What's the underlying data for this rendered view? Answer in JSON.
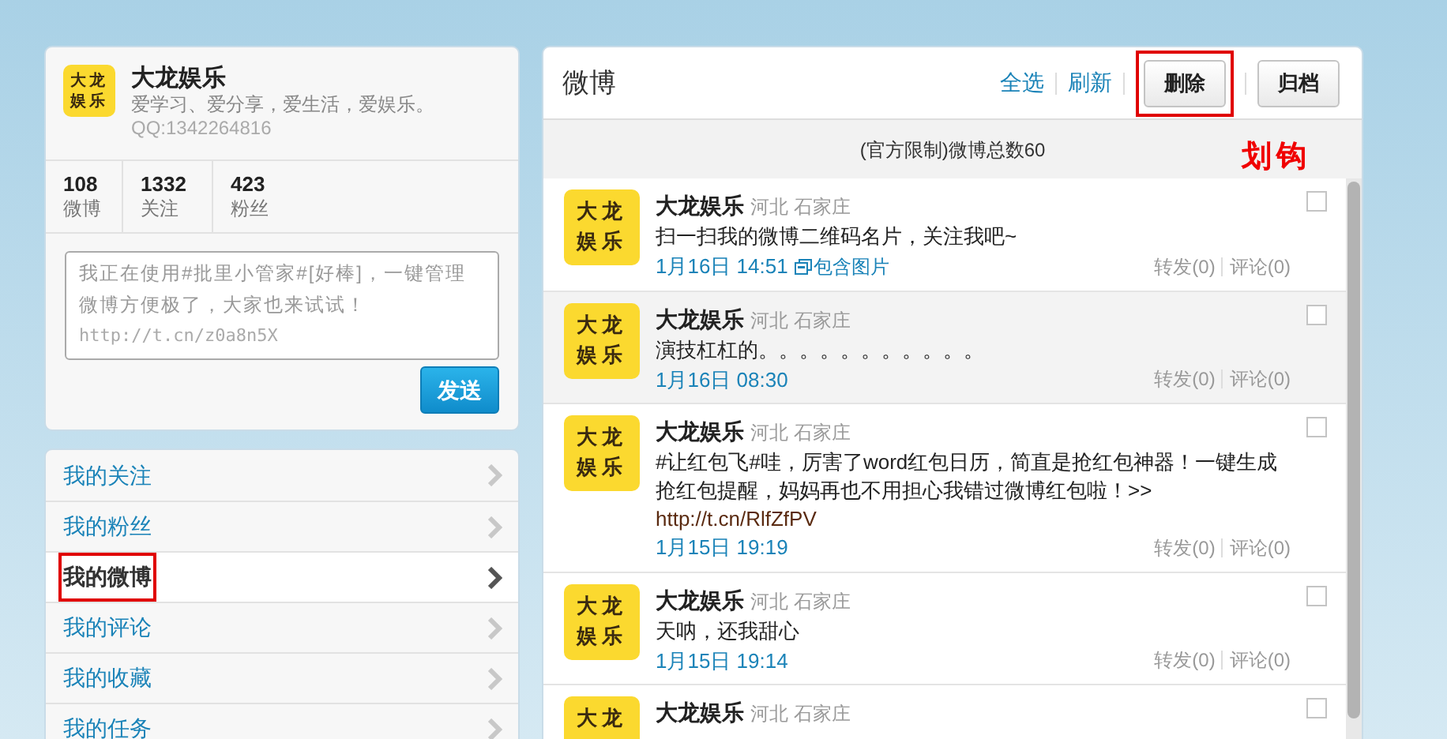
{
  "profile": {
    "avatar_text": "大龙娱乐",
    "name": "大龙娱乐",
    "bio": "爱学习、爱分享，爱生活，爱娱乐。",
    "qq": "QQ:1342264816",
    "stats": [
      {
        "value": "108",
        "label": "微博"
      },
      {
        "value": "1332",
        "label": "关注"
      },
      {
        "value": "423",
        "label": "粉丝"
      }
    ]
  },
  "composer": {
    "value": "我正在使用#批里小管家#[好棒]，一键管理微博方便极了，大家也来试试！",
    "url": "http://t.cn/z0a8n5X",
    "button": "发送"
  },
  "nav": [
    {
      "label": "我的关注",
      "selected": false,
      "annotated": false
    },
    {
      "label": "我的粉丝",
      "selected": false,
      "annotated": false
    },
    {
      "label": "我的微博",
      "selected": true,
      "annotated": true
    },
    {
      "label": "我的评论",
      "selected": false,
      "annotated": false
    },
    {
      "label": "我的收藏",
      "selected": false,
      "annotated": false
    },
    {
      "label": "我的任务",
      "selected": false,
      "annotated": false
    }
  ],
  "panel": {
    "title": "微博",
    "actions": [
      {
        "label": "全选",
        "kind": "link",
        "annotated": false
      },
      {
        "label": "刷新",
        "kind": "link",
        "annotated": false
      },
      {
        "label": "删除",
        "kind": "button",
        "annotated": true
      },
      {
        "label": "归档",
        "kind": "button",
        "annotated": false
      }
    ],
    "notice": "(官方限制)微博总数60",
    "annotation": "划钩",
    "posts": [
      {
        "avatar_text": "大龙娱乐",
        "name": "大龙娱乐",
        "location": "河北 石家庄",
        "text": "扫一扫我的微博二维码名片，关注我吧~",
        "date": "1月16日 14:51",
        "attachment": "包含图片",
        "repost": "转发(0)",
        "comment": "评论(0)",
        "checked": false,
        "highlighted": false
      },
      {
        "avatar_text": "大龙娱乐",
        "name": "大龙娱乐",
        "location": "河北 石家庄",
        "text": "演技杠杠的。。。。。。。。。。。",
        "date": "1月16日 08:30",
        "repost": "转发(0)",
        "comment": "评论(0)",
        "checked": false,
        "highlighted": true
      },
      {
        "avatar_text": "大龙娱乐",
        "name": "大龙娱乐",
        "location": "河北 石家庄",
        "text": "#让红包飞#哇，厉害了word红包日历，简直是抢红包神器！一键生成抢红包提醒，妈妈再也不用担心我错过微博红包啦！>>",
        "link": "http://t.cn/RlfZfPV",
        "date": "1月15日 19:19",
        "repost": "转发(0)",
        "comment": "评论(0)",
        "checked": false,
        "highlighted": false
      },
      {
        "avatar_text": "大龙娱乐",
        "name": "大龙娱乐",
        "location": "河北 石家庄",
        "text": "天呐，还我甜心",
        "date": "1月15日 19:14",
        "repost": "转发(0)",
        "comment": "评论(0)",
        "checked": false,
        "highlighted": false
      },
      {
        "avatar_text": "大龙",
        "name": "大龙娱乐",
        "location": "河北 石家庄",
        "checked": false,
        "highlighted": false
      }
    ]
  }
}
